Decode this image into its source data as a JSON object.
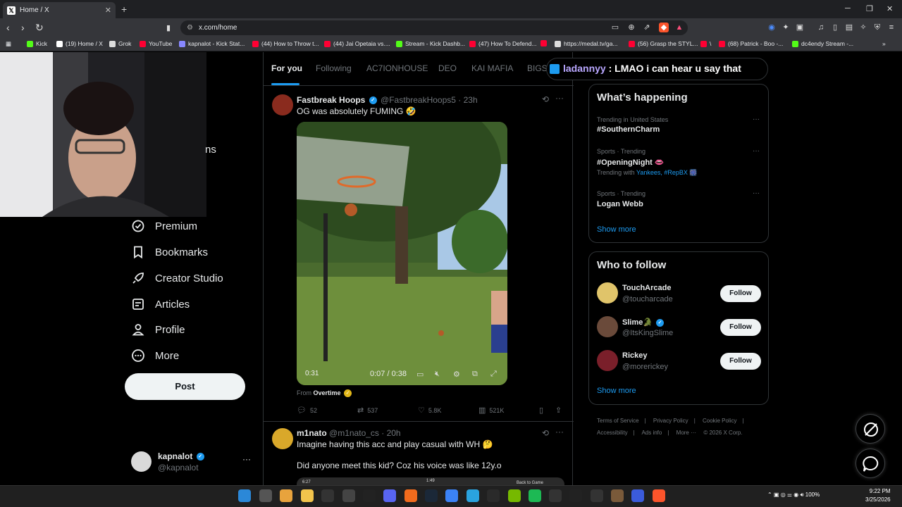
{
  "browser": {
    "tab_title": "Home / X",
    "tab_close": "✕",
    "new_tab": "+",
    "url": "x.com/home",
    "win_min": "─",
    "win_max": "❐",
    "win_close": "✕",
    "bookmarks": [
      {
        "label": "Kick",
        "color": "#53fc18"
      },
      {
        "label": "(19) Home / X",
        "color": "#ffffff"
      },
      {
        "label": "Grok",
        "color": "#dddddd"
      },
      {
        "label": "YouTube",
        "color": "#ff0033"
      },
      {
        "label": "kapnalot - Kick Stat...",
        "color": "#8888ff"
      },
      {
        "label": "(44) How to Throw t...",
        "color": "#ff0033"
      },
      {
        "label": "(44) Jai Opetaia vs....",
        "color": "#ff0033"
      },
      {
        "label": "Stream - Kick Dashb...",
        "color": "#53fc18"
      },
      {
        "label": "(47) How To Defend...",
        "color": "#ff0033"
      },
      {
        "label": "",
        "color": "#ff0033"
      },
      {
        "label": "https://medal.tv/ga...",
        "color": "#dddddd"
      },
      {
        "label": "(56) Grasp the STYL...",
        "color": "#ff0033"
      },
      {
        "label": "\\",
        "color": "#ff0033"
      },
      {
        "label": "(68) Patrick - Boo -...",
        "color": "#ff0033"
      },
      {
        "label": "dc4endy Stream -...",
        "color": "#53fc18"
      }
    ]
  },
  "sidebar": {
    "partial_label": "ns",
    "items": [
      {
        "label": "Premium",
        "icon": "premium-icon"
      },
      {
        "label": "Bookmarks",
        "icon": "bookmark-icon"
      },
      {
        "label": "Creator Studio",
        "icon": "rocket-icon"
      },
      {
        "label": "Articles",
        "icon": "articles-icon"
      },
      {
        "label": "Profile",
        "icon": "person-icon"
      },
      {
        "label": "More",
        "icon": "more-circle-icon"
      }
    ],
    "post_label": "Post",
    "account": {
      "name": "kapnalot",
      "handle": "@kapnalot",
      "menu": "···"
    }
  },
  "feed": {
    "tabs": [
      "For you",
      "Following",
      "AC7IONHOUSE",
      "DEO",
      "KAI MAFIA",
      "BIGSI"
    ],
    "tweet1": {
      "name": "Fastbreak Hoops",
      "handle": "@FastbreakHoops5 · 23h",
      "text": "OG was absolutely FUMING 🤣",
      "video_time_left": "0:31",
      "video_time": "0:07 / 0:38",
      "from_label": "From",
      "from_source": "Overtime",
      "replies": "52",
      "reposts": "537",
      "likes": "5.8K",
      "views": "521K"
    },
    "tweet2": {
      "name": "m1nato",
      "handle": "@m1nato_cs · 20h",
      "text": "Imagine having this acc and play casual with WH 🤔",
      "text2": "Did anyone meet this kid? Coz his voice was like 12y.o",
      "thumb_left": "6:27",
      "thumb_mid": "1:49",
      "thumb_right": "Back to Game"
    }
  },
  "chat_overlay": {
    "user": "ladannyy",
    "text": " : LMAO i can hear u say that"
  },
  "trending": {
    "title": "What’s happening",
    "items": [
      {
        "meta": "Trending in United States",
        "name": "#SouthernCharm",
        "sub": "",
        "sub_links": ""
      },
      {
        "meta": "Sports · Trending",
        "name": "#OpeningNight 👄",
        "sub": "Trending with ",
        "sub_links": "Yankees, #RepBX 🎆"
      },
      {
        "meta": "Sports · Trending",
        "name": "Logan Webb",
        "sub": "",
        "sub_links": ""
      }
    ],
    "show_more": "Show more"
  },
  "who_to_follow": {
    "title": "Who to follow",
    "accounts": [
      {
        "name": "TouchArcade",
        "handle": "@toucharcade",
        "button": "Follow"
      },
      {
        "name": "Slime🐊",
        "handle": "@ItsKingSlime",
        "button": "Follow"
      },
      {
        "name": "Rickey",
        "handle": "@morerickey",
        "button": "Follow"
      }
    ],
    "show_more": "Show more"
  },
  "footer_links": [
    "Terms of Service",
    "|",
    "Privacy Policy",
    "|",
    "Cookie Policy",
    "|",
    "Accessibility",
    "|",
    "Ads info",
    "|",
    "More ···",
    "© 2026 X Corp."
  ],
  "taskbar": {
    "time": "9:22 PM",
    "date": "3/25/2026",
    "battery": "100%"
  },
  "colors": {
    "accent": "#1d9bf0",
    "bg": "#000000",
    "border": "#2f3336",
    "muted": "#71767b"
  }
}
